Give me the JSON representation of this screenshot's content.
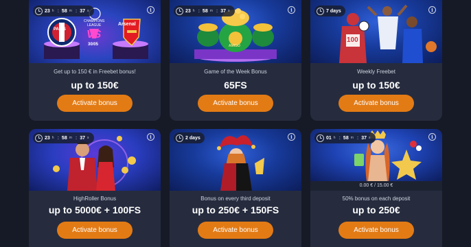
{
  "colors": {
    "page_bg": "#161a26",
    "card_bg": "#262c3e",
    "button": "#e37b15",
    "hero_blue": "#1e46b4"
  },
  "cards": [
    {
      "timer": {
        "h": "23",
        "m": "58",
        "s": "37"
      },
      "hero": {
        "club_left": "PARIS",
        "league_line1": "CHAMPIONS",
        "league_line2": "LEAGUE",
        "club_right": "Arsenal",
        "vs": "VS",
        "date": "30/05"
      },
      "description": "Get up to 150 € in Freebet bonus!",
      "amount": "up to 150€",
      "button": "Activate bonus"
    },
    {
      "timer": {
        "h": "23",
        "m": "58",
        "s": "37"
      },
      "hero": {
        "pot_label": "AMIGO"
      },
      "description": "Game of the Week Bonus",
      "amount": "65FS",
      "button": "Activate bonus"
    },
    {
      "timer_days": "7 days",
      "hero": {
        "jersey": "100"
      },
      "description": "Weekly Freebet",
      "amount": "up to 150€",
      "button": "Activate bonus"
    },
    {
      "timer": {
        "h": "23",
        "m": "58",
        "s": "37"
      },
      "description": "HighRoller Bonus",
      "amount": "up to 5000€ + 100FS",
      "button": "Activate bonus"
    },
    {
      "timer_days": "2 days",
      "description": "Bonus on every third deposit",
      "amount": "up to 250€ + 150FS",
      "button": "Activate bonus"
    },
    {
      "timer": {
        "h": "01",
        "m": "58",
        "s": "37"
      },
      "progress": "0.00 € / 15.00 €",
      "description": "50% bonus on each deposit",
      "amount": "up to 250€",
      "button": "Activate bonus"
    }
  ],
  "timer_units": {
    "h": "h",
    "m": "m",
    "s": "s"
  },
  "info_symbol": "i"
}
